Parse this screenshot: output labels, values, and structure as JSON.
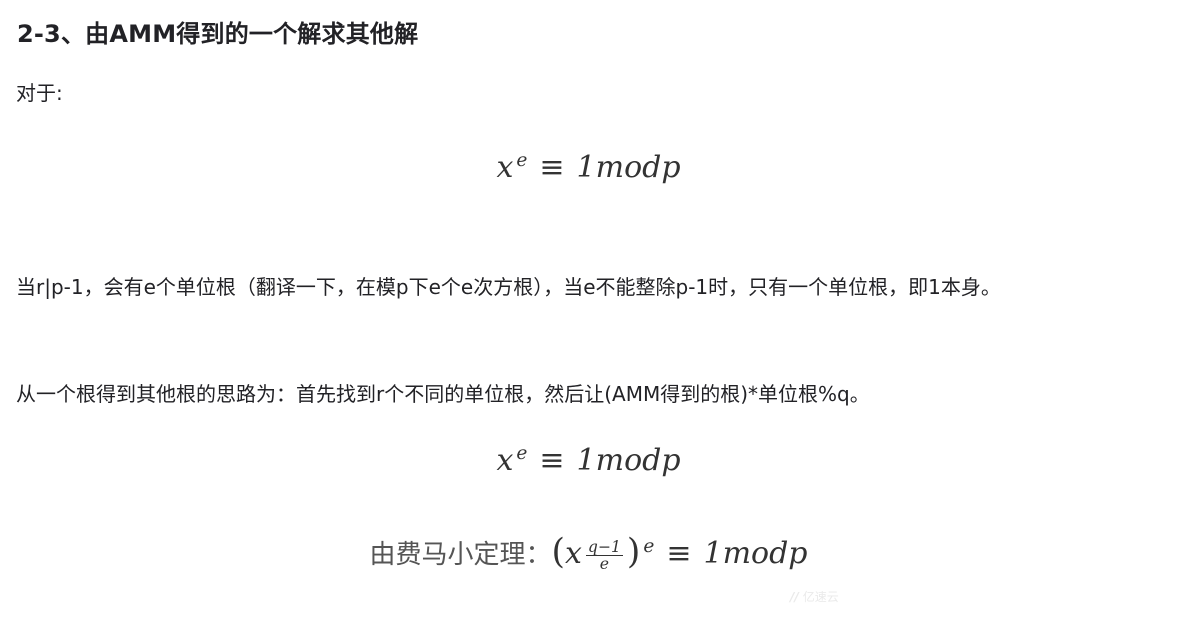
{
  "heading": "2-3、由AMM得到的一个解求其他解",
  "intro": "对于:",
  "formula1": {
    "base": "x",
    "exp": "e",
    "op": "≡",
    "rhs": "1modp"
  },
  "para1": "当r|p-1，会有e个单位根（翻译一下，在模p下e个e次方根），当e不能整除p-1时，只有一个单位根，即1本身。",
  "para2": "从一个根得到其他根的思路为：首先找到r个不同的单位根，然后让(AMM得到的根)*单位根%q。",
  "formula2": {
    "base": "x",
    "exp": "e",
    "op": "≡",
    "rhs": "1modp"
  },
  "formula3": {
    "prefix": "由费马小定理：",
    "open": "(",
    "base": "x",
    "frac_num": "q−1",
    "frac_den": "e",
    "close": ")",
    "exp": "e",
    "op": "≡",
    "rhs": "1modp"
  },
  "watermark": {
    "logo": "//",
    "text": "亿速云"
  }
}
